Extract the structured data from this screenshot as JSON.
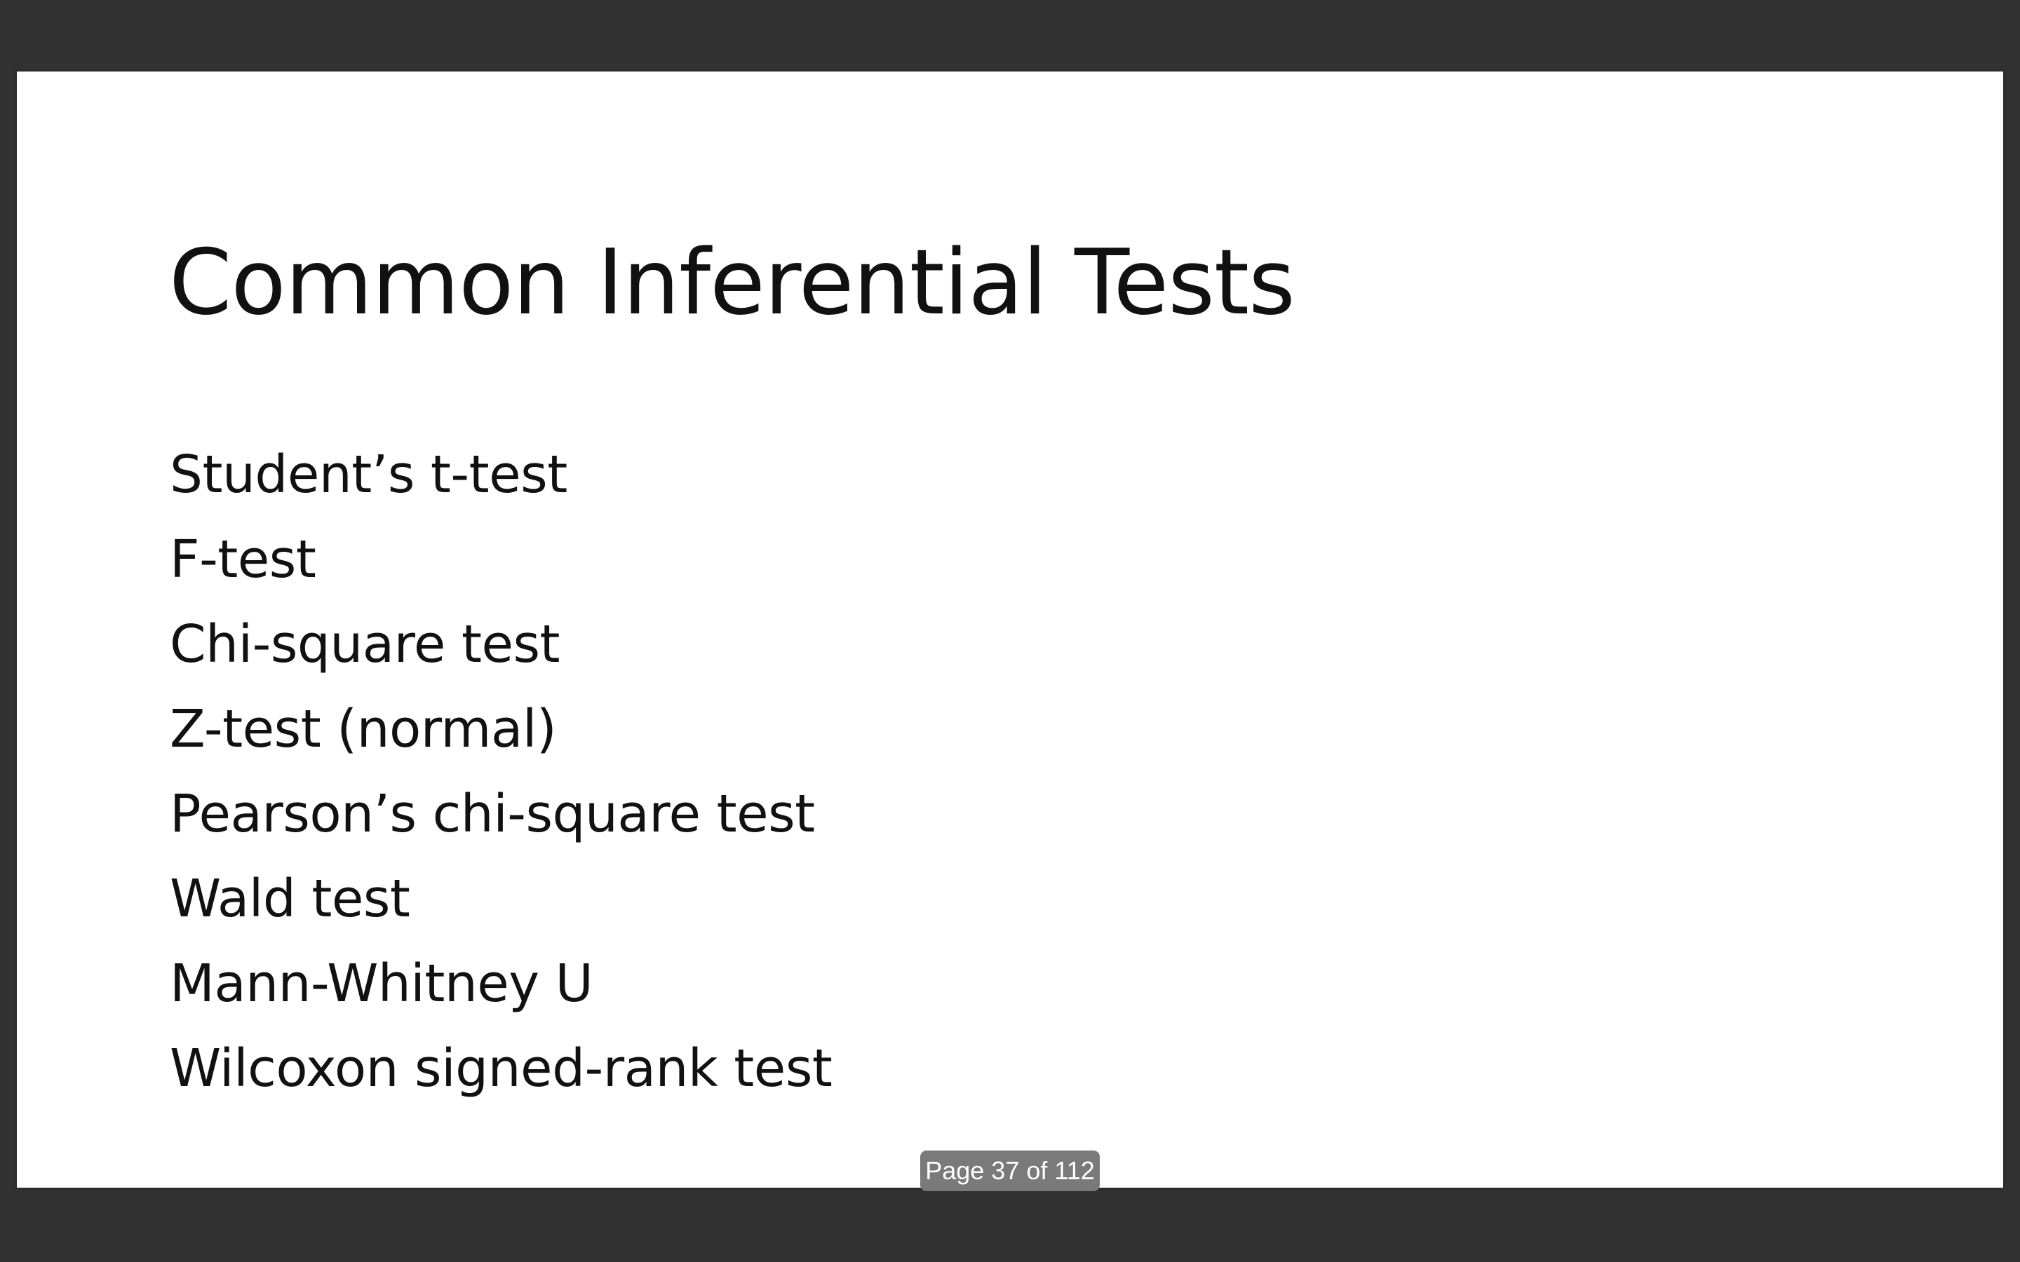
{
  "slide": {
    "title": "Common Inferential Tests",
    "bullets": [
      "Student’s t-test",
      "F-test",
      "Chi-square test",
      "Z-test (normal)",
      "Pearson’s chi-square test",
      "Wald test",
      "Mann-Whitney U",
      "Wilcoxon signed-rank test"
    ]
  },
  "page_indicator": {
    "text": "Page 37 of 112"
  },
  "colors": {
    "viewer_background": "#323232",
    "slide_background": "#ffffff",
    "text": "#111111",
    "indicator_background": "#7a7a7a"
  }
}
